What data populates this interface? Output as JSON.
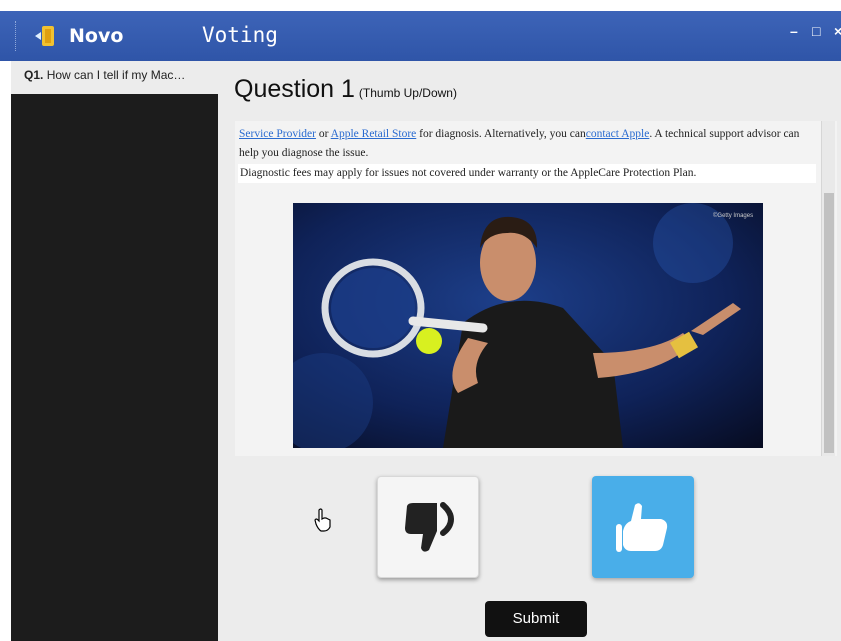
{
  "titlebar": {
    "app_name": "Novo",
    "window_title": "Voting",
    "minimize_glyph": "–",
    "maximize_glyph": "□",
    "close_glyph": "×"
  },
  "sidebar": {
    "items": [
      {
        "number": "Q1.",
        "label": "How can I tell if my Mac…"
      }
    ]
  },
  "question": {
    "title": "Question 1",
    "type": "(Thumb Up/Down)"
  },
  "document": {
    "link1": "Service Provider",
    "or": " or ",
    "link2": "Apple Retail Store",
    "text1": " for diagnosis. Alternatively, you can",
    "link3": "contact Apple",
    "text2": ". A technical support advisor can help you diagnose the issue.",
    "note": "Diagnostic fees may apply for issues not covered under warranty or the AppleCare Protection Plan.",
    "photo_credit": "©Getty Images"
  },
  "vote": {
    "thumb_down_icon": "thumb-down-icon",
    "thumb_up_icon": "thumb-up-icon",
    "selected": "thumb-up"
  },
  "submit_label": "Submit",
  "colors": {
    "titlebar": "#2f55a8",
    "thumb_up_selected": "#49aee9",
    "submit": "#111111"
  }
}
